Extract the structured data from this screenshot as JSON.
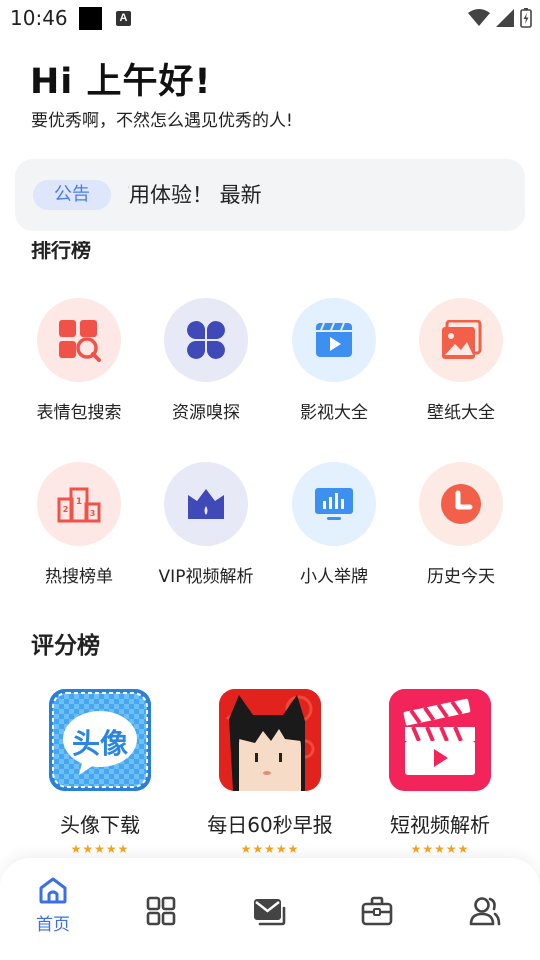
{
  "status": {
    "time": "10:46",
    "a_icon_letter": "A"
  },
  "greeting": {
    "title": "Hi 上午好!",
    "subtitle": "要优秀啊，不然怎么遇见优秀的人!"
  },
  "notice": {
    "tag": "公告",
    "text": "更新，给你带来更好的使用体验！   最新"
  },
  "ranking": {
    "title": "排行榜"
  },
  "features": [
    {
      "label": "表情包搜索",
      "icon": "emoji-search-icon"
    },
    {
      "label": "资源嗅探",
      "icon": "four-petal-icon"
    },
    {
      "label": "影视大全",
      "icon": "movie-clapper-icon"
    },
    {
      "label": "壁纸大全",
      "icon": "wallpaper-image-icon"
    },
    {
      "label": "热搜榜单",
      "icon": "podium-icon"
    },
    {
      "label": "VIP视频解析",
      "icon": "crown-icon"
    },
    {
      "label": "小人举牌",
      "icon": "sign-board-icon"
    },
    {
      "label": "历史今天",
      "icon": "clock-icon"
    }
  ],
  "score_section": {
    "title": "评分榜",
    "apps": [
      {
        "name": "头像下载",
        "icon_text": "头像",
        "stars": "★★★★★"
      },
      {
        "name": "每日60秒早报",
        "icon_text": "",
        "stars": "★★★★★"
      },
      {
        "name": "短视频解析",
        "icon_text": "",
        "stars": "★★★★★"
      }
    ]
  },
  "nav": {
    "home_label": "首页",
    "active_color": "#3b6ee8",
    "inactive_color": "#444444"
  },
  "colors": {
    "accent_blue": "#3b6ee8",
    "red_icon": "#f0524a",
    "indigo_icon": "#3f4ab8",
    "blue_icon": "#3d8ff0",
    "orange_icon": "#f2604a"
  }
}
